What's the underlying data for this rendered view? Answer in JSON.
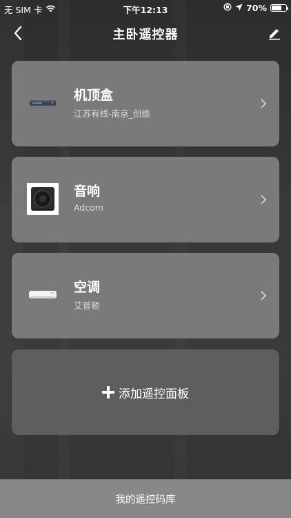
{
  "status_bar": {
    "carrier": "无 SIM 卡",
    "time": "下午12:13",
    "battery": "70%",
    "battery_level": 0.7
  },
  "nav": {
    "title": "主卧遥控器"
  },
  "devices": [
    {
      "name": "机顶盒",
      "subtitle": "江苏有线-南京_创维",
      "icon": "set-top-box-icon"
    },
    {
      "name": "音响",
      "subtitle": "Adcom",
      "icon": "speaker-icon"
    },
    {
      "name": "空调",
      "subtitle": "艾普顿",
      "icon": "air-conditioner-icon"
    }
  ],
  "add_panel": {
    "label": "添加遥控面板"
  },
  "bottom": {
    "label": "我的遥控码库"
  }
}
